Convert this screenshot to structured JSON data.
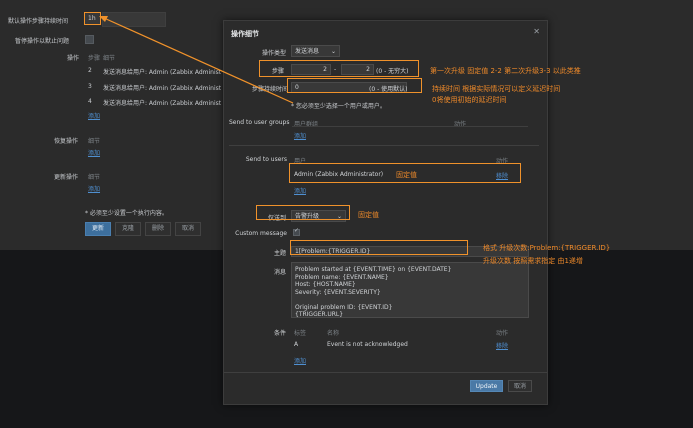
{
  "background": {
    "default_duration_label": "默认操作步骤持续时间",
    "default_duration_value": "1h",
    "pause_label": "暂停操作以默止问题",
    "operations_label": "操作",
    "ops_header_steps": "步骤",
    "ops_header_details": "细节",
    "ops_rows": [
      {
        "step": "2",
        "detail": "发送消息给用户: Admin (Zabbix Administrator)"
      },
      {
        "step": "3",
        "detail": "发送消息给用户: Admin (Zabbix Administrator)"
      },
      {
        "step": "4",
        "detail": "发送消息给用户: Admin (Zabbix Administrator)"
      }
    ],
    "add_link": "添加",
    "recovery_label": "恢复操作",
    "recovery_header": "细节",
    "recovery_add": "添加",
    "update_ops_label": "更新操作",
    "update_header": "细节",
    "update_add": "添加",
    "required_note": "* 必须至少设置一个执行内容。",
    "buttons": [
      "更新",
      "克隆",
      "删除",
      "取消"
    ]
  },
  "dialog": {
    "title": "操作细节",
    "close_icon": "close-icon",
    "operation_type_label": "操作类型",
    "operation_type_value": "发送消息",
    "steps_label": "步骤",
    "steps_from": "2",
    "steps_dash": "-",
    "steps_to": "2",
    "steps_hint": "(0 - 无穷大)",
    "step_duration_label": "步骤持续时间",
    "step_duration_value": "0",
    "step_duration_hint": "(0 - 使用默认)",
    "must_select_note": "* 您必须至少选择一个用户或用户。",
    "send_groups_label": "Send to user groups",
    "groups_header_group": "用户群组",
    "groups_header_action": "动作",
    "groups_add": "添加",
    "send_users_label": "Send to users",
    "users_header_user": "用户",
    "users_header_action": "动作",
    "user_row_name": "Admin (Zabbix Administrator)",
    "user_row_remove": "移除",
    "users_add": "添加",
    "default_media_label": "仅送到",
    "default_media_value": "告警升级",
    "custom_message_label": "Custom message",
    "subject_label": "主题",
    "subject_value": "1[Problem:{TRIGGER.ID}",
    "message_label": "消息",
    "message_value": "Problem started at {EVENT.TIME} on {EVENT.DATE}\nProblem name: {EVENT.NAME}\nHost: {HOST.NAME}\nSeverity: {EVENT.SEVERITY}\n\nOriginal problem ID: {EVENT.ID}\n{TRIGGER.URL}",
    "conditions_label": "条件",
    "cond_header_label": "标签",
    "cond_header_name": "名称",
    "cond_header_action": "动作",
    "cond_row_label": "A",
    "cond_row_name": "Event is not acknowledged",
    "cond_row_remove": "移除",
    "cond_add": "添加",
    "update_button": "Update",
    "cancel_button": "取消"
  },
  "annotations": {
    "steps_note": "第一次升级 固定值 2-2  第二次升级3-3 以此类推",
    "duration_note_1": "持续时间 根据实际情况可以定义延迟时间",
    "duration_note_2": "0将使用初始的延迟时间",
    "fixed_value_1": "固定值",
    "fixed_value_2": "固定值",
    "subject_note_1": "格式   升级次数:Problem:{TRIGGER.ID}",
    "subject_note_2": "升级次数 按照需求指定 由1递增"
  },
  "colors": {
    "accent_orange": "#f0922b",
    "link_blue": "#4f8fd0",
    "primary_button": "#4a79a6"
  }
}
